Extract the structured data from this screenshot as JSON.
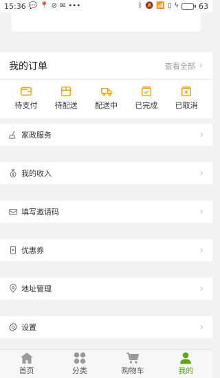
{
  "status": {
    "time": "15:36",
    "battery": "63",
    "battery_level": 0.63
  },
  "orders": {
    "title": "我的订单",
    "view_all": "查看全部",
    "items": [
      {
        "label": "待支付"
      },
      {
        "label": "待配送"
      },
      {
        "label": "配送中"
      },
      {
        "label": "已完成"
      },
      {
        "label": "已取消"
      }
    ]
  },
  "menu": [
    {
      "label": "家政服务"
    },
    {
      "label": "我的收入"
    },
    {
      "label": "填写邀请码"
    },
    {
      "label": "优惠券"
    },
    {
      "label": "地址管理"
    },
    {
      "label": "设置"
    }
  ],
  "tabs": [
    {
      "label": "首页"
    },
    {
      "label": "分类"
    },
    {
      "label": "购物车"
    },
    {
      "label": "我的",
      "active": true
    }
  ],
  "colors": {
    "accent": "#f5a000",
    "active_tab": "#5aa814"
  }
}
